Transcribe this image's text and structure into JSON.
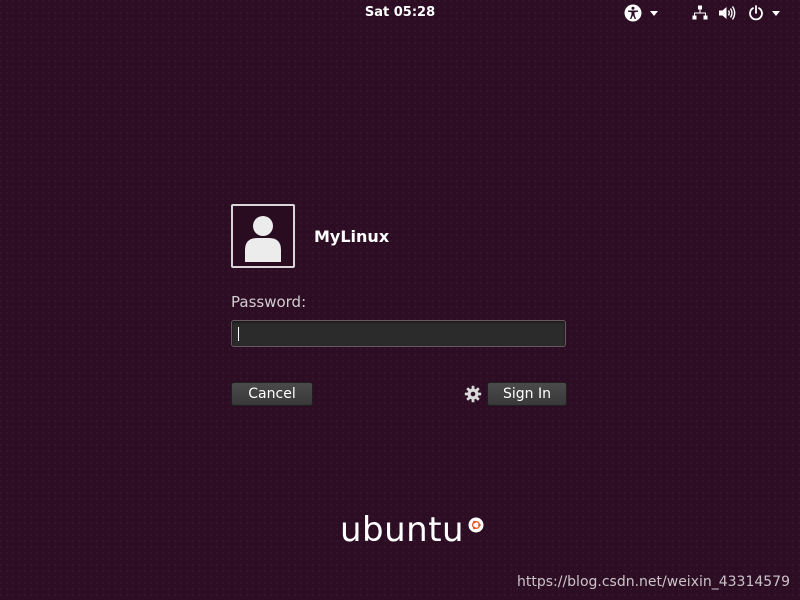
{
  "top_bar": {
    "clock": "Sat 05:28",
    "icons": [
      "accessibility-icon",
      "network-icon",
      "volume-icon",
      "power-icon"
    ]
  },
  "login": {
    "username": "MyLinux",
    "password_label": "Password:",
    "password_value": "",
    "cancel_label": "Cancel",
    "sign_in_label": "Sign In",
    "settings_icon": "gear-icon"
  },
  "branding": {
    "logo_text": "ubuntu"
  },
  "watermark": {
    "text": "https://blog.csdn.net/weixin_43314579"
  },
  "colors": {
    "background": "#2c0d23",
    "panel_text": "#ffffff",
    "button": "#404040",
    "logo_accent": "#e95420"
  }
}
